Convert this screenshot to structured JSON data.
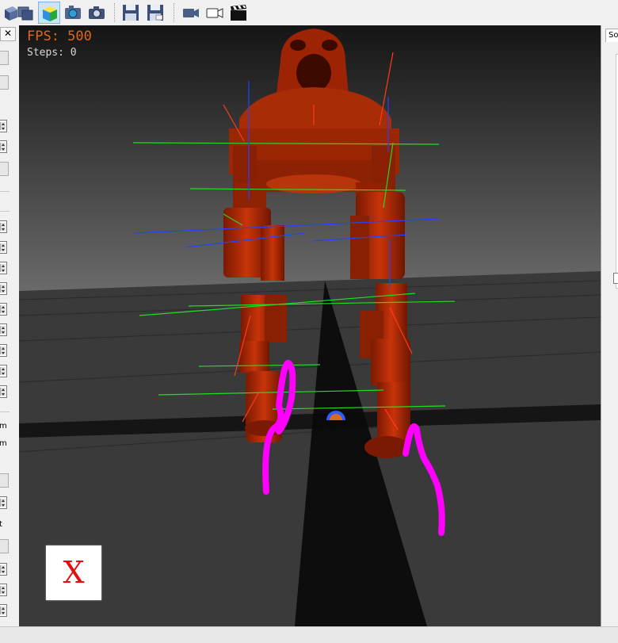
{
  "toolbar": {
    "buttons": [
      {
        "name": "view-box-icon"
      },
      {
        "name": "view-layers-icon"
      },
      {
        "name": "view-cube-icon",
        "active": true
      },
      {
        "name": "camera-snapshot-icon"
      },
      {
        "name": "camera-icon"
      },
      {
        "name": "save-icon"
      },
      {
        "name": "save-all-icon"
      },
      {
        "name": "video-camera-icon"
      },
      {
        "name": "video-record-icon"
      },
      {
        "name": "clapperboard-icon"
      }
    ]
  },
  "left_panel": {
    "close_label": "✕",
    "label_m1": "m",
    "label_m2": "m",
    "label_t": "t"
  },
  "viewport": {
    "fps_label": "FPS: 500",
    "steps_label": "Steps: 0",
    "axis_label": "X"
  },
  "right_panel": {
    "tab_label": "So"
  },
  "colors": {
    "robot": "#b22a05",
    "trajectory": "#ff00ff",
    "fps_text": "#e0661b",
    "axis_text": "#e01010"
  }
}
